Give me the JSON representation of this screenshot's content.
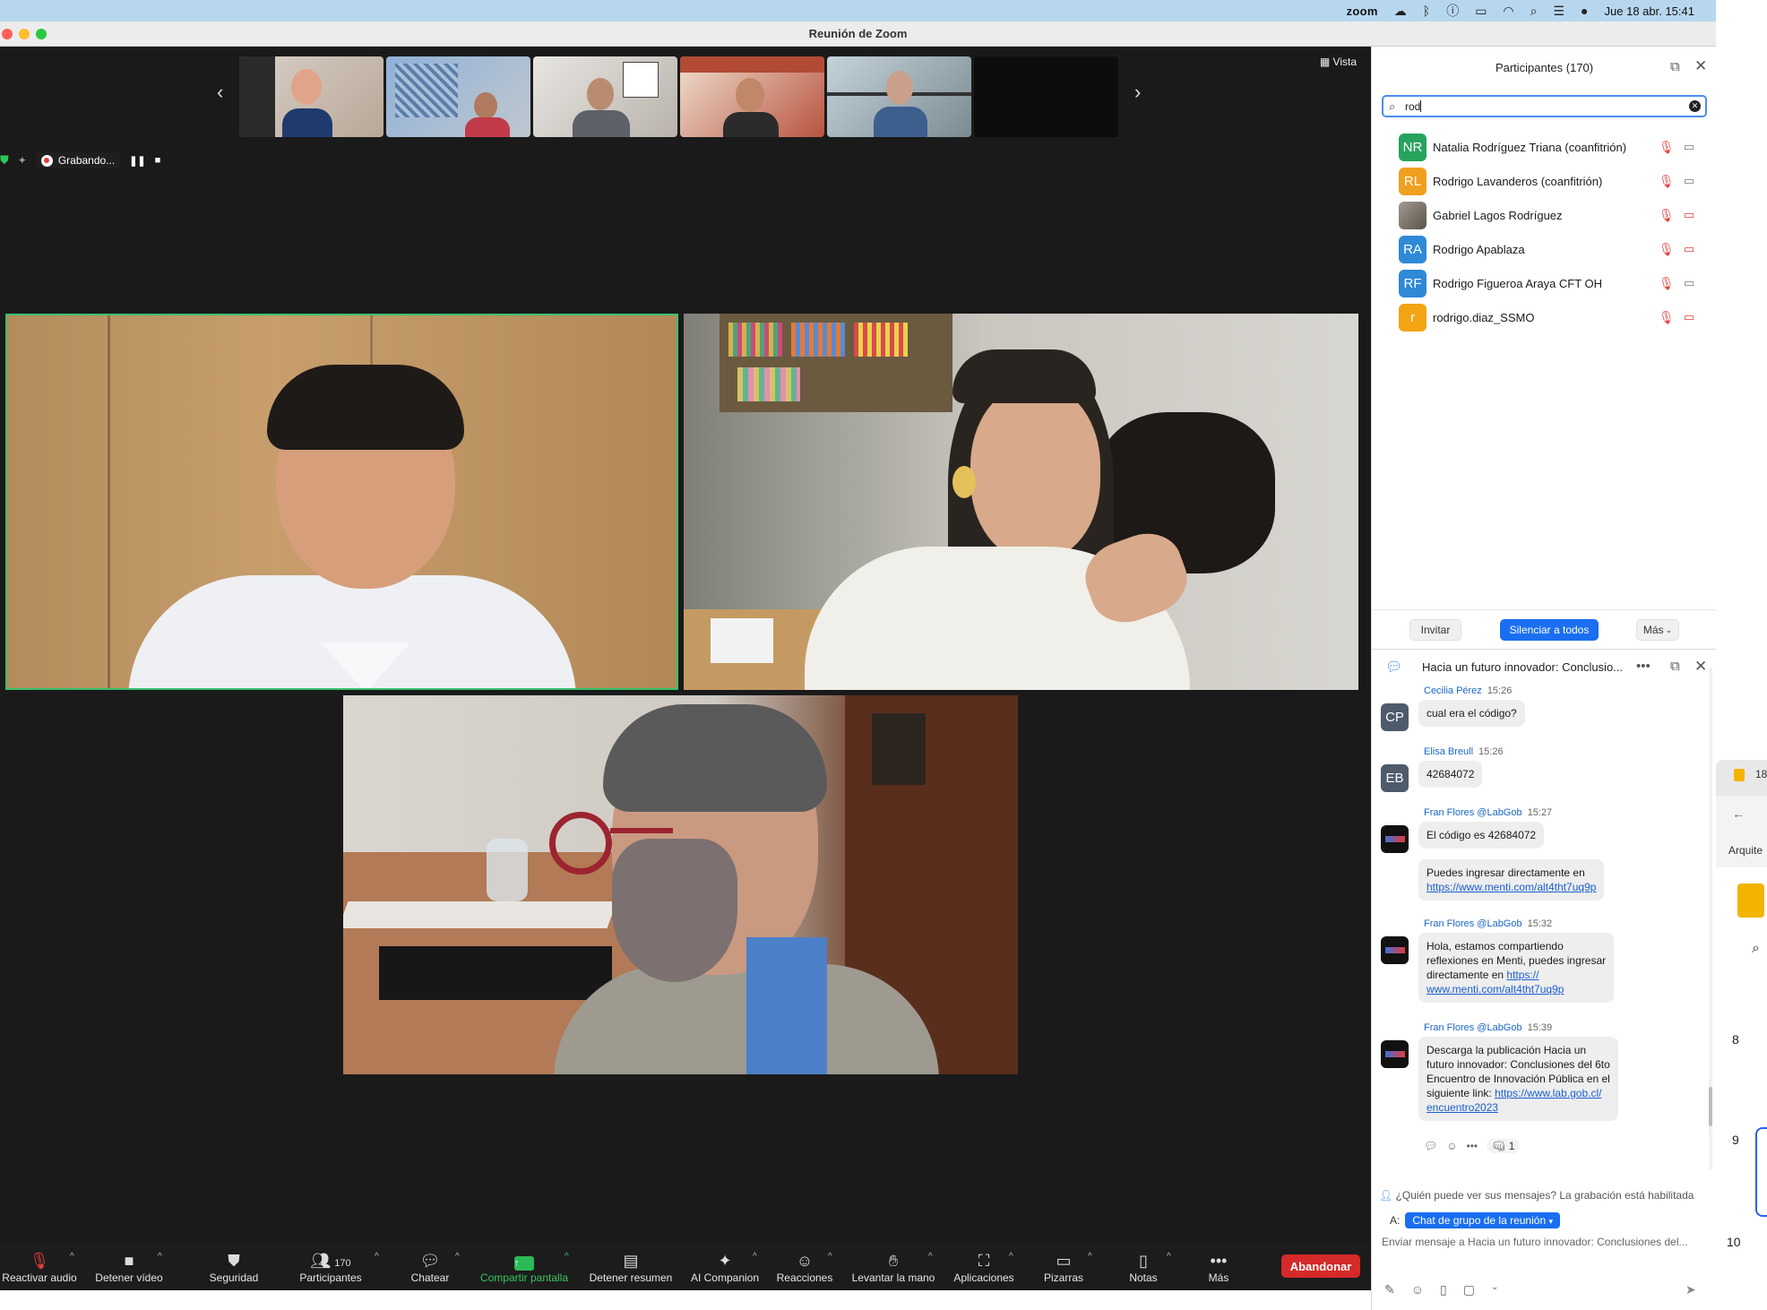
{
  "menubar": {
    "app_word": "zoom",
    "datetime": "Jue 18 abr.  15:41"
  },
  "window": {
    "title": "Reunión de Zoom"
  },
  "gallery": {
    "view_label": "Vista"
  },
  "recording": {
    "label": "Grabando..."
  },
  "toolbar": {
    "unmute": "Reactivar audio",
    "stop_video": "Detener vídeo",
    "security": "Seguridad",
    "participants": "Participantes",
    "participants_count": "170",
    "chat": "Chatear",
    "share": "Compartir pantalla",
    "stop_summary": "Detener resumen",
    "ai_companion": "AI Companion",
    "reactions": "Reacciones",
    "raise_hand": "Levantar la mano",
    "apps": "Aplicaciones",
    "whiteboards": "Pizarras",
    "notes": "Notas",
    "more": "Más",
    "leave": "Abandonar"
  },
  "participants_panel": {
    "title": "Participantes (170)",
    "search_value": "rod",
    "participants": [
      {
        "initials": "NR",
        "name": "Natalia Rodríguez Triana (coanfitrión)",
        "color": "#27a35e",
        "video_off": false
      },
      {
        "initials": "RL",
        "name": "Rodrigo Lavanderos (coanfitrión)",
        "color": "#f0a020",
        "video_off": false
      },
      {
        "initials": "",
        "name": "Gabriel Lagos Rodríguez",
        "color": "#8a7f75",
        "video_off": true
      },
      {
        "initials": "RA",
        "name": "Rodrigo Apablaza",
        "color": "#2e89d6",
        "video_off": true
      },
      {
        "initials": "RF",
        "name": "Rodrigo Figueroa Araya CFT OH",
        "color": "#2e89d6",
        "video_off": false
      },
      {
        "initials": "r",
        "name": "rodrigo.diaz_SSMO",
        "color": "#f2a413",
        "video_off": true
      }
    ],
    "invite": "Invitar",
    "mute_all": "Silenciar a todos",
    "more": "Más"
  },
  "chat": {
    "title": "Hacia un futuro innovador: Conclusio...",
    "messages": [
      {
        "initials": "CP",
        "sender": "Cecilia Pérez",
        "time": "15:26",
        "text": "cual era el código?",
        "color": "#4d5b6b"
      },
      {
        "initials": "EB",
        "sender": "Elisa Breull",
        "time": "15:26",
        "text": "42684072",
        "color": "#4d5b6b"
      },
      {
        "sender": "Fran Flores @LabGob",
        "time": "15:27",
        "text": "El código es 42684072",
        "text2": "Puedes ingresar directamente en",
        "link": "https://www.menti.com/alt4tht7uq9p"
      },
      {
        "sender": "Fran Flores @LabGob",
        "time": "15:32",
        "text_l1": "Hola, estamos compartiendo",
        "text_l2": "reflexiones en Menti, puedes ingresar",
        "text_l3": "directamente en",
        "link_l1": "https://",
        "link_l2": "www.menti.com/alt4tht7uq9p"
      },
      {
        "sender": "Fran Flores @LabGob",
        "time": "15:39",
        "l1": "Descarga la publicación Hacia un",
        "l2": "futuro innovador: Conclusiones del 6to",
        "l3": "Encuentro de Innovación Pública en el",
        "l4": "siguiente link:",
        "link_l1": "https://www.lab.gob.cl/",
        "link_l2": "encuentro2023",
        "reaction_count": "1"
      }
    ],
    "privacy_note": "¿Quién puede ver sus mensajes? La grabación está habilitada",
    "to_label": "A:",
    "recipient": "Chat de grupo de la reunión",
    "input_placeholder": "Enviar mensaje a Hacia un futuro innovador: Conclusiones del..."
  },
  "sliver": {
    "top_text": "18",
    "mid_text": "Arquite",
    "n8": "8",
    "n9": "9",
    "n10": "10"
  }
}
